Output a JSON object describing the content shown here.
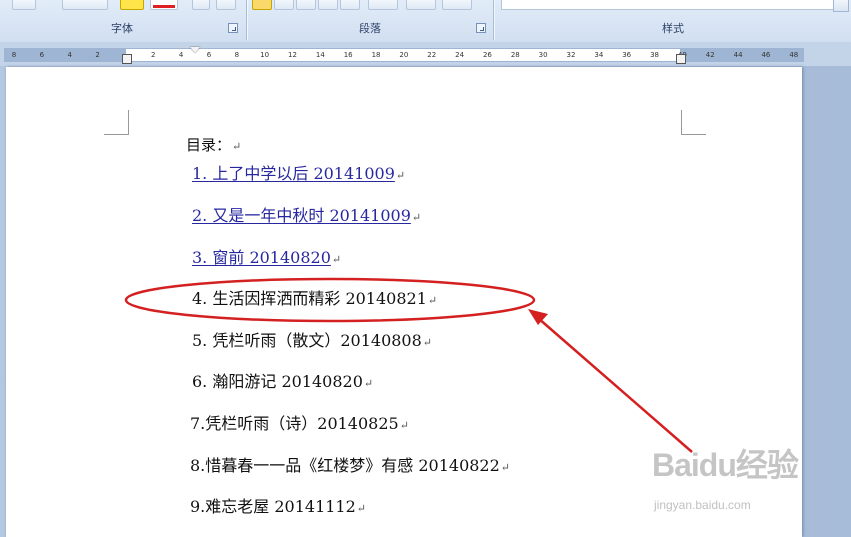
{
  "ribbon": {
    "groups": [
      {
        "label": "字体"
      },
      {
        "label": "段落"
      },
      {
        "label": "样式"
      }
    ]
  },
  "ruler": {
    "ticks": [
      "8",
      "6",
      "4",
      "2",
      "",
      "2",
      "4",
      "6",
      "8",
      "10",
      "12",
      "14",
      "16",
      "18",
      "20",
      "22",
      "24",
      "26",
      "28",
      "30",
      "32",
      "34",
      "36",
      "38",
      "40",
      "42",
      "44",
      "46",
      "48"
    ]
  },
  "document": {
    "heading": "目录：",
    "entries": [
      {
        "text": "1. 上了中学以后  20141009",
        "link": true
      },
      {
        "text": "2. 又是一年中秋时  20141009",
        "link": true
      },
      {
        "text": "3. 窗前  20140820",
        "link": true
      },
      {
        "text": "4. 生活因挥洒而精彩 20140821",
        "link": false,
        "highlighted": true
      },
      {
        "text": "5. 凭栏听雨（散文）20140808",
        "link": false
      },
      {
        "text": "6. 瀚阳游记 20140820",
        "link": false
      },
      {
        "text": "7.凭栏听雨（诗）20140825",
        "link": false
      },
      {
        "text": "8.惜暮春一一品《红楼梦》有感 20140822",
        "link": false
      },
      {
        "text": "9.难忘老屋  20141112",
        "link": false
      }
    ],
    "paragraph_mark": "↵"
  },
  "annotation": {
    "color": "#d42020"
  },
  "watermark": {
    "text": "Baidu经验",
    "url": "jingyan.baidu.com"
  }
}
